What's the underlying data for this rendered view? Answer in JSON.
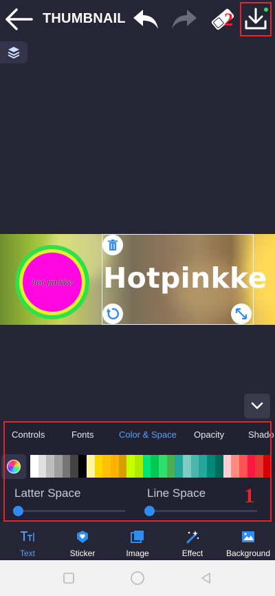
{
  "header": {
    "title": "THUMBNAIL",
    "annotation_2": "2"
  },
  "canvas": {
    "logo_text": "hot pinkke",
    "headline": "Hotpinkke"
  },
  "panel": {
    "tabs": [
      {
        "label": "Controls",
        "active": false
      },
      {
        "label": "Fonts",
        "active": false
      },
      {
        "label": "Color & Space",
        "active": true
      },
      {
        "label": "Opacity",
        "active": false
      },
      {
        "label": "Shado",
        "active": false
      }
    ],
    "palette": [
      "#ffffff",
      "#e0e0e0",
      "#bdbdbd",
      "#9e9e9e",
      "#757575",
      "#424242",
      "#000000",
      "#fff59d",
      "#ffd600",
      "#ffc107",
      "#ffb300",
      "#d4a100",
      "#c6ff00",
      "#aeea00",
      "#00e676",
      "#00c853",
      "#2ee06b",
      "#4caf50",
      "#26a69a",
      "#80cbc4",
      "#4db6ac",
      "#26a69a",
      "#00897b",
      "#00695c",
      "#ffcdd2",
      "#ff8a80",
      "#ff5252",
      "#ff1744",
      "#e53935",
      "#d50000"
    ],
    "latter_space_label": "Latter Space",
    "line_space_label": "Line Space",
    "latter_space_value": 0,
    "line_space_value": 0,
    "annotation_1": "1"
  },
  "bottom_nav": {
    "items": [
      {
        "label": "Text",
        "icon": "text-icon",
        "active": true
      },
      {
        "label": "Sticker",
        "icon": "sticker-icon",
        "active": false
      },
      {
        "label": "Image",
        "icon": "image-icon",
        "active": false
      },
      {
        "label": "Effect",
        "icon": "effect-icon",
        "active": false
      },
      {
        "label": "Background",
        "icon": "background-icon",
        "active": false
      }
    ]
  },
  "colors": {
    "accent": "#4fa3f7",
    "annotation": "#e8232a",
    "background": "#262536"
  }
}
